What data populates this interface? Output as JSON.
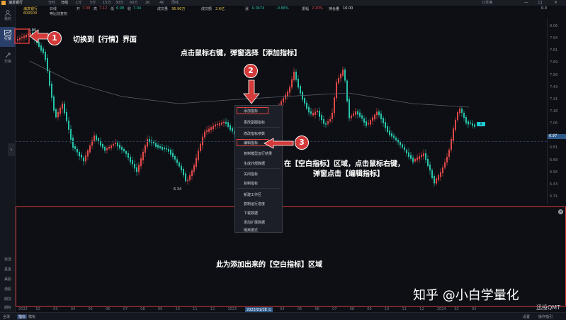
{
  "topbar": {
    "stock_tab": "浦发银行",
    "tabs": [
      "分时",
      "日线",
      "1分",
      "5分",
      "15分",
      "30分",
      "60分",
      "2K",
      "4K",
      "周线"
    ],
    "active_tab": "日线",
    "right_label": "订单簿",
    "win_controls": [
      "—",
      "□",
      "×"
    ]
  },
  "sidebar": {
    "items": [
      {
        "label": "我的"
      },
      {
        "label": "行情"
      },
      {
        "label": "交易"
      }
    ],
    "bottom_items": [
      "自选",
      "基金",
      "美股",
      "港股",
      "期货",
      "期权"
    ]
  },
  "info": {
    "name": "浦发银行",
    "code": "600000",
    "period": "日线",
    "adjust": "等比前复权",
    "open_label": "开",
    "open": "7.09",
    "high_label": "高",
    "high": "7.12",
    "low_label": "低",
    "low": "6.98",
    "close_label": "收",
    "close": "7.04",
    "volume_label": "成交量",
    "volume": "36.96万",
    "amount_label": "成交额",
    "amount": "2.6亿",
    "change_label": "涨",
    "change": "-0.0474",
    "change_pct": "-0.66%",
    "amp_label": "振幅",
    "amp": "2.20%",
    "hold_label": "持仓量",
    "hold": "16.00",
    "extra": "0.0"
  },
  "yaxis": [
    "8.06",
    "7.94",
    "7.81",
    "7.69",
    "7.56",
    "7.43",
    "7.31",
    "7.18",
    "7.06",
    "6.94",
    "6.81",
    "6.68",
    "6.56",
    "6.43",
    "6.31"
  ],
  "chart_marks": {
    "high": "6.90",
    "low": "6.34",
    "last_price": "6.97",
    "tag": "0"
  },
  "dateaxis": [
    "2022",
    "02",
    "03",
    "04",
    "05",
    "06",
    "07",
    "08",
    "09",
    "10",
    "11",
    "12",
    "2023",
    "2023/01/08 三",
    "03",
    "04",
    "05",
    "06",
    "07",
    "08",
    "09",
    "10",
    "11",
    "12",
    "2024",
    "02",
    "03"
  ],
  "bottombar": {
    "tabs": [
      "全球",
      "指标",
      "模板"
    ],
    "right": [
      "设置",
      "操作指引"
    ]
  },
  "context_menu": {
    "items": [
      "添加指标",
      "更改副图指标",
      "修改指标参数",
      "编辑指标",
      "复制模型运行结果",
      "生成外部数据",
      "关闭指标",
      "复制指标",
      "新建工作区",
      "复制运行进度",
      "下载数据",
      "添加扩展数据",
      "隔离模式"
    ]
  },
  "annotations": {
    "step1_num": "1",
    "step1_text": "切换到【行情】界面",
    "step2_num": "2",
    "step2_text": "点击鼠标右键，弹窗选择【添加指标】",
    "step3_num": "3",
    "step3_line1": "在【空白指标】区域，点击鼠标右键，",
    "step3_line2": "弹窗点击【编辑指标】",
    "empty_text": "此为添加出来的【空白指标】区域"
  },
  "watermark": "知乎 @小白学量化",
  "watermark_small": "迅投QMT",
  "colors": {
    "up": "#e04848",
    "down": "#27c2a8",
    "annotation_red": "#d43a3a",
    "accent_blue": "#2a3f6a"
  }
}
